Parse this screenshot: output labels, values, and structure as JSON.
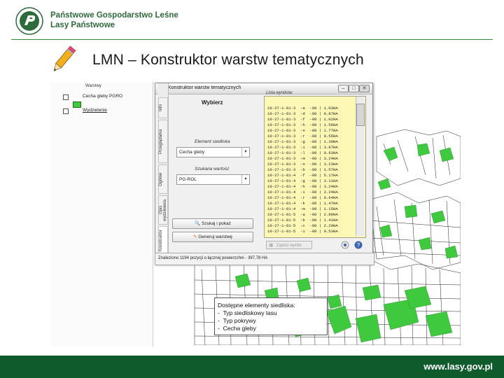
{
  "header": {
    "org_line1": "Państwowe Gospodarstwo Leśne",
    "org_line2": "Lasy Państwowe",
    "slide_title": "LMN – Konstruktor warstw tematycznych"
  },
  "footer": {
    "url": "www.lasy.gov.pl"
  },
  "layers_panel": {
    "title": "Warstwy",
    "items": [
      "Cecha gleby PGRO",
      "Wydzielenie"
    ]
  },
  "side_tabs": [
    "Info",
    "Przeglądarka",
    "Ogólne",
    "Opis wydzielenia",
    "Konstruktor"
  ],
  "dialog": {
    "title": "Konstruktor warstw tematycznych",
    "choose_label": "Wybierz",
    "element_label": "Element siedliska",
    "element_value": "Cecha gleby",
    "value_label": "Szukana wartość",
    "value_value": "PG-ROL",
    "search_button": "Szukaj i pokaż",
    "generate_button": "Generuj warstwę",
    "results_title": "Lista wyników:",
    "results": [
      "10-27-1-01-3  -a  -00 | 1.03HA",
      "10-27-1-01-3  -d  -00 | 0.87HA",
      "10-27-1-01-3  -f  -00 | 1.02HA",
      "10-27-1-01-3  -h  -00 | 1.56HA",
      "10-27-1-01-3  -n  -00 | 1.77HA",
      "10-27-1-01-3  -r  -00 | 0.55HA",
      "10-27-1-01-3  -g  -00 | 1.30HA",
      "10-27-1-01-3  -i  -00 | 3.87HA",
      "10-27-1-01-3  -l  -00 | 0.63HA",
      "10-27-1-01-3  -m  -00 | 3.24HA",
      "10-27-1-01-3  -n  -00 | 3.23HA",
      "10-27-1-01-3  -b  -00 | 1.57HA",
      "10-27-1-01-4  -f  -00 | 5.17HA",
      "10-27-1-01-4  -g  -00 | 3.11HA",
      "10-27-1-01-4  -h  -00 | 3.24HA",
      "10-27-1-01-4  -i  -00 | 2.24HA",
      "10-27-1-01-4  -r  -00 | 0.64HA",
      "10-27-1-01-4  -k  -00 | 1.47HA",
      "10-27-1-01-4  -m  -00 | 1.15HA",
      "10-27-1-01-5  -a  -00 | 2.99HA",
      "10-27-1-01-5  -b  -00 | 1.41HA",
      "10-27-1-01-5  -c  -00 | 2.29HA",
      "10-27-1-01-5  -i  -00 | 0.53HA"
    ],
    "save_button": "Zapisz wyniki",
    "status": "Znaleziono 1194 pozycji o łącznej powierzchni - 397,78 HA"
  },
  "info_box": {
    "heading": "Dostępne elementy siedliska:",
    "items": [
      "Typ siedliskowy lasu",
      "Typ pokrywy",
      "Cecha gleby"
    ]
  },
  "colors": {
    "brand_green": "#0f5b2c",
    "map_green": "#3ec93e",
    "results_bg": "#fdf8b5"
  },
  "icons": [
    "pgl-logo-icon",
    "pencil-icon",
    "search-icon",
    "generate-icon",
    "save-icon",
    "settings-icon",
    "help-icon"
  ]
}
